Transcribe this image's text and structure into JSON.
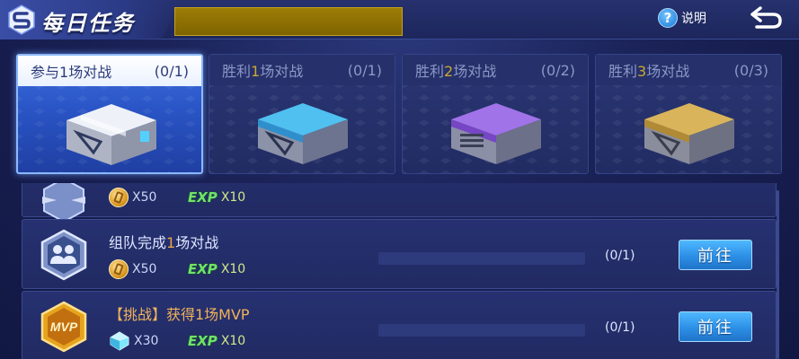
{
  "header": {
    "title": "每日任务",
    "help_label": "说明",
    "help_icon": "question-mark-icon",
    "back_icon": "back-arrow-icon"
  },
  "tabs": [
    {
      "prefix": "参与",
      "num": "1",
      "suffix": "场对战",
      "count": "(0/1)",
      "active": true,
      "chest_color": "#c9ccd6",
      "trim_color": "#54d0ff"
    },
    {
      "prefix": "胜利",
      "num": "1",
      "suffix": "场对战",
      "count": "(0/1)",
      "active": false,
      "chest_color": "#3aa8e0",
      "trim_color": "#9ce3ff"
    },
    {
      "prefix": "胜利",
      "num": "2",
      "suffix": "场对战",
      "count": "(0/2)",
      "active": false,
      "chest_color": "#8a57d6",
      "trim_color": "#c7a6ff"
    },
    {
      "prefix": "胜利",
      "num": "3",
      "suffix": "场对战",
      "count": "(0/3)",
      "active": false,
      "chest_color": "#c9a14a",
      "trim_color": "#f3d68a"
    }
  ],
  "tasks": [
    {
      "name": "",
      "icon": "wings-badge-icon",
      "rewards": [
        {
          "type": "coin",
          "amount": "X50"
        },
        {
          "type": "exp",
          "label": "EXP",
          "amount": "X10"
        }
      ],
      "progress_text": "",
      "progress": 0,
      "button": ""
    },
    {
      "name_prefix": "组队完成",
      "name_num": "1",
      "name_suffix": "场对战",
      "icon": "team-badge-icon",
      "rewards": [
        {
          "type": "coin",
          "amount": "X50"
        },
        {
          "type": "exp",
          "label": "EXP",
          "amount": "X10"
        }
      ],
      "progress_text": "(0/1)",
      "progress": 0,
      "button": "前往"
    },
    {
      "name": "【挑战】获得1场MVP",
      "icon": "mvp-badge-icon",
      "icon_text": "MVP",
      "rewards": [
        {
          "type": "diamond",
          "amount": "X30"
        },
        {
          "type": "exp",
          "label": "EXP",
          "amount": "X10"
        }
      ],
      "progress_text": "(0/1)",
      "progress": 0,
      "button": "前往"
    }
  ]
}
